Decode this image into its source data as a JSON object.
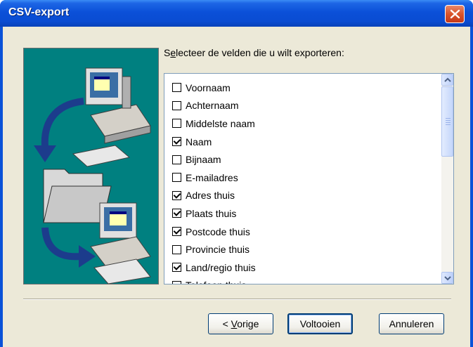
{
  "window": {
    "title": "CSV-export"
  },
  "prompt": {
    "before": "S",
    "underlined": "e",
    "after": "lecteer de velden die u wilt exporteren:"
  },
  "fields": [
    {
      "label": "Voornaam",
      "checked": false
    },
    {
      "label": "Achternaam",
      "checked": false
    },
    {
      "label": "Middelste naam",
      "checked": false
    },
    {
      "label": "Naam",
      "checked": true
    },
    {
      "label": "Bijnaam",
      "checked": false
    },
    {
      "label": "E-mailadres",
      "checked": false
    },
    {
      "label": "Adres thuis",
      "checked": true
    },
    {
      "label": "Plaats thuis",
      "checked": true
    },
    {
      "label": "Postcode thuis",
      "checked": true
    },
    {
      "label": "Provincie thuis",
      "checked": false
    },
    {
      "label": "Land/regio thuis",
      "checked": true
    },
    {
      "label": "Telefoon thuis",
      "checked": false
    }
  ],
  "buttons": {
    "back_prefix": "< ",
    "back_underlined": "V",
    "back_rest": "orige",
    "finish": "Voltooien",
    "cancel": "Annuleren"
  },
  "colors": {
    "titlebar": "#0a4cd2",
    "panel": "#008080",
    "dialog": "#ece9d8",
    "close": "#d9542a"
  }
}
